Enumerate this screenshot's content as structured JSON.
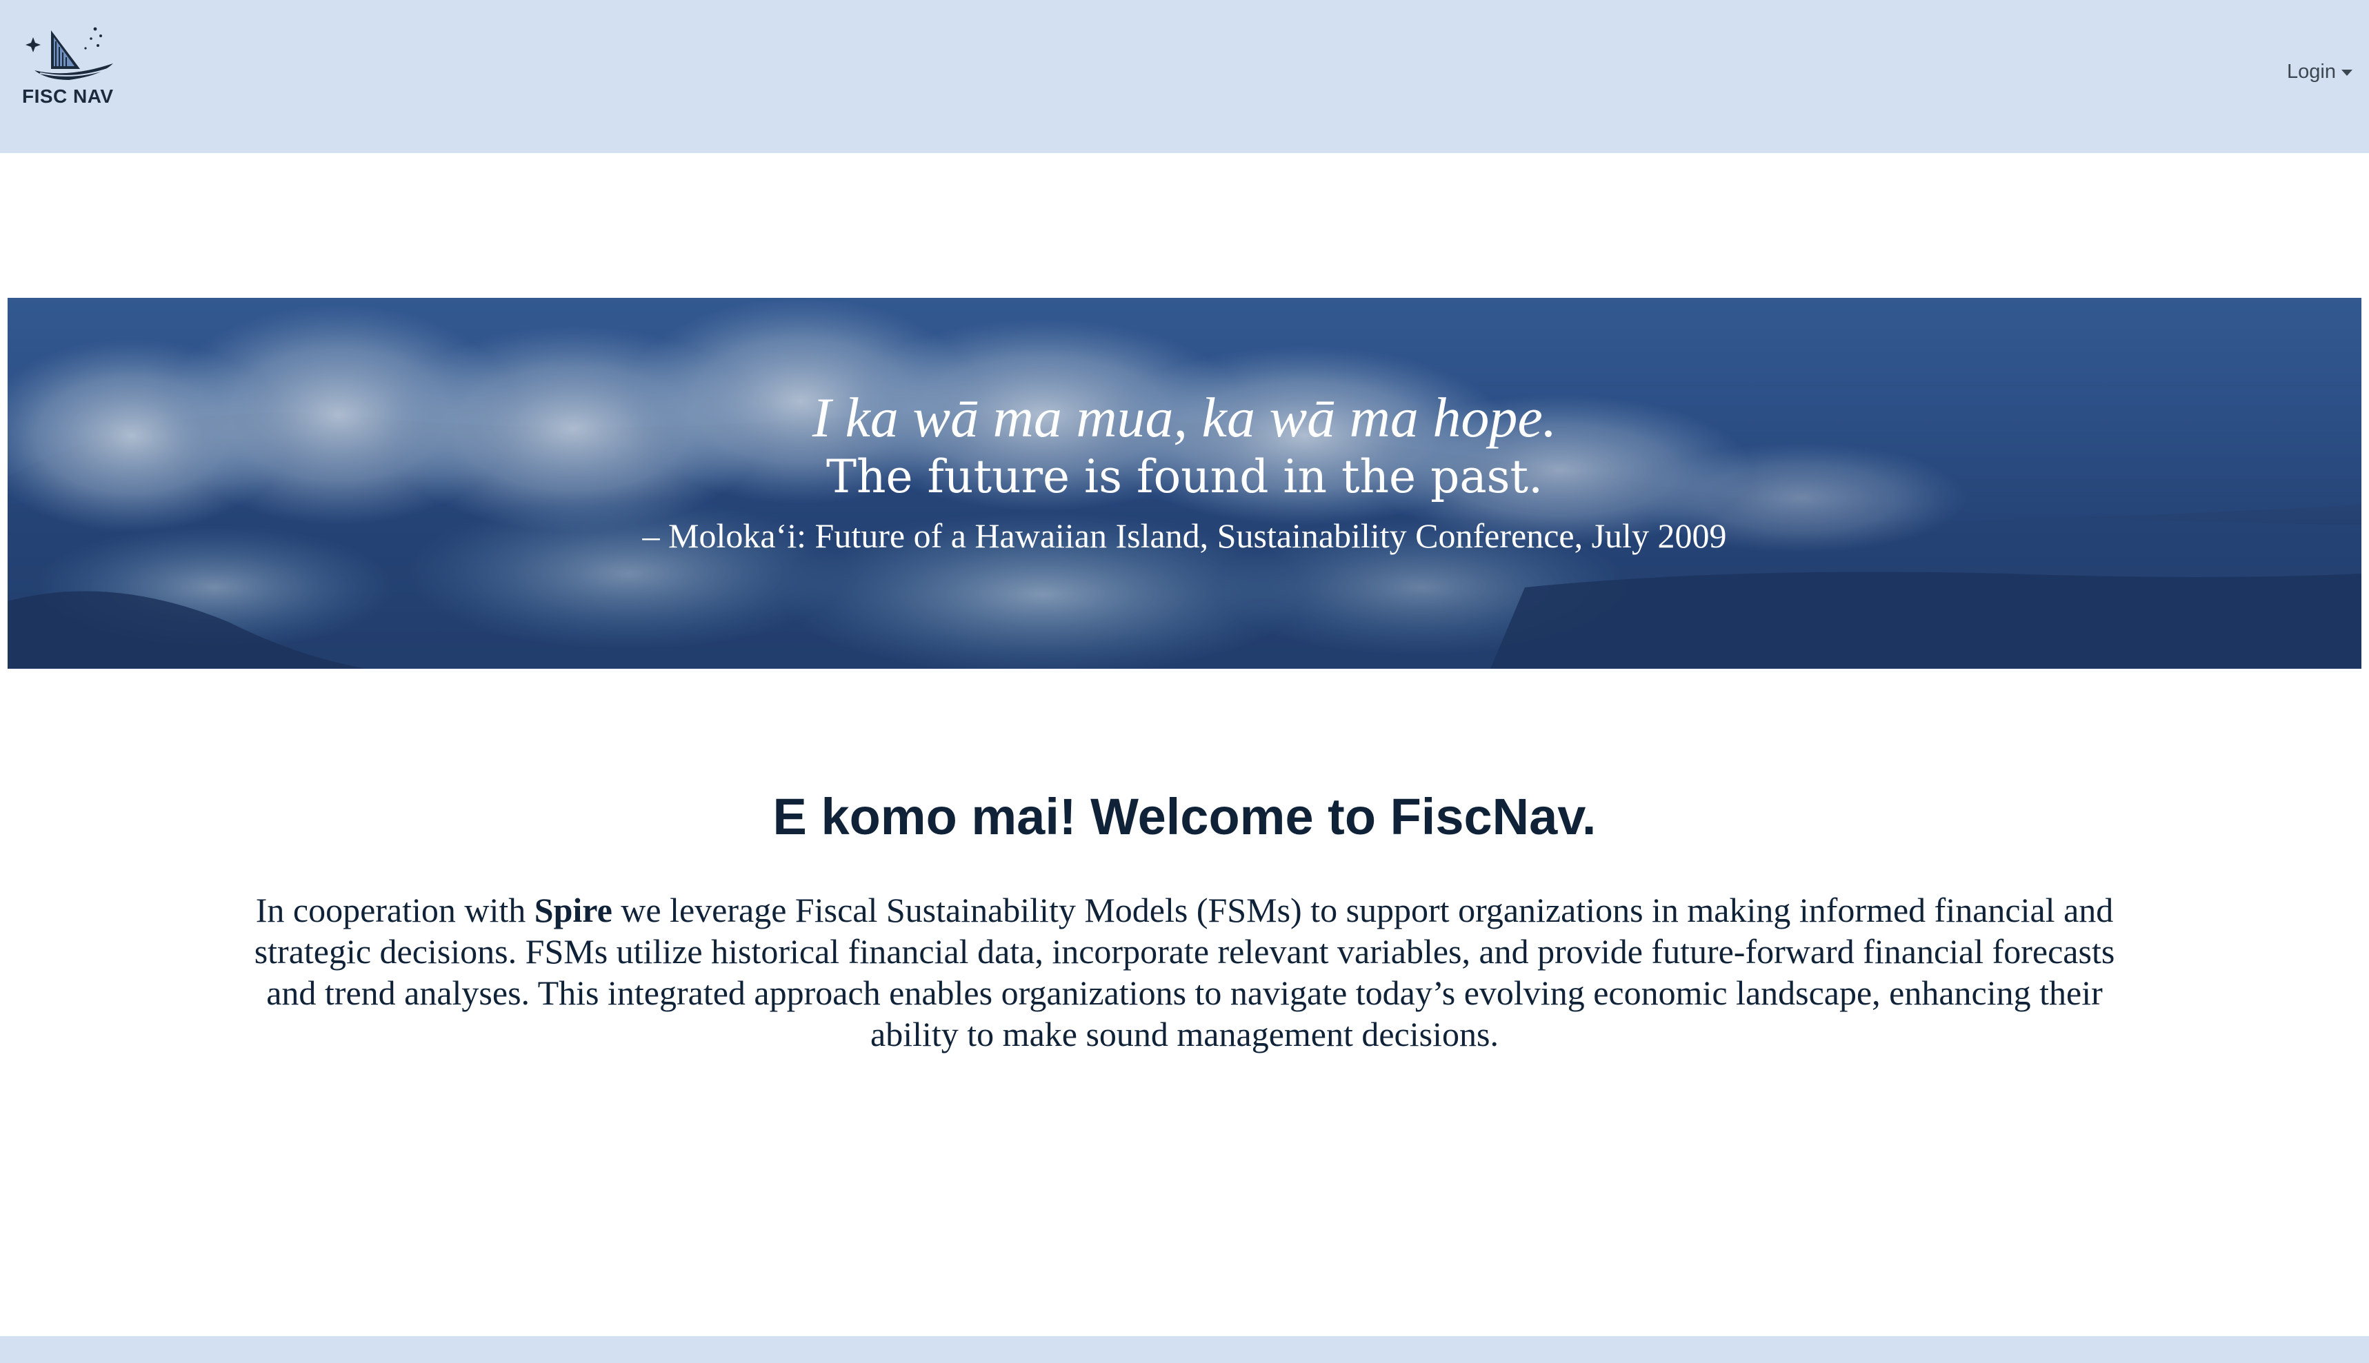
{
  "navbar": {
    "brand_text": "FISC NAV",
    "logo_icon": "canoe-stars-logo",
    "login_label": "Login"
  },
  "hero": {
    "quote_hawaiian": "I ka wā ma mua, ka wā ma hope.",
    "quote_english": "The future is found in the past.",
    "quote_source": "– Molokaʻi: Future of a Hawaiian Island, Sustainability Conference, July 2009"
  },
  "main": {
    "heading": "E komo mai! Welcome to FiscNav.",
    "intro_before": "In cooperation with ",
    "intro_bold": "Spire",
    "intro_after": " we leverage Fiscal Sustainability Models (FSMs) to support organizations in making informed financial and strategic decisions. FSMs utilize historical financial data, incorporate relevant variables, and provide future-forward financial forecasts and trend analyses. This integrated approach enables organizations to navigate today’s evolving economic landscape, enhancing their ability to make sound management decisions."
  },
  "colors": {
    "navbar_bg": "#d3e0f1",
    "heading_text": "#0f2238",
    "hero_sky": "#3a64a0"
  }
}
